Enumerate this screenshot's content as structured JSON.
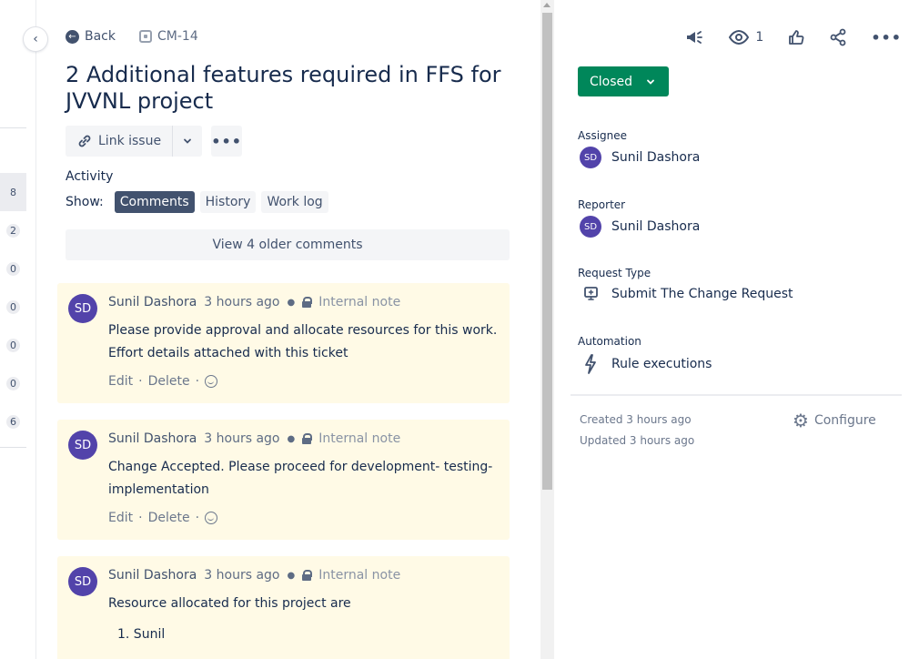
{
  "left_strip": {
    "counts": [
      "8",
      "2",
      "0",
      "0",
      "0",
      "0",
      "6"
    ]
  },
  "nav": {
    "back_label": "Back",
    "issue_key": "CM-14"
  },
  "issue": {
    "title": "2 Additional features required in FFS for JVVNL project"
  },
  "actions": {
    "link_issue": "Link issue",
    "more": "•••"
  },
  "activity": {
    "label": "Activity",
    "show_label": "Show:",
    "filters": [
      "Comments",
      "History",
      "Work log"
    ],
    "active_filter": "Comments",
    "older_comments": "View 4 older comments"
  },
  "comments": [
    {
      "initials": "SD",
      "author": "Sunil Dashora",
      "time": "3 hours ago",
      "visibility": "Internal note",
      "body": "Please provide approval and allocate resources for this work. Effort details attached with this ticket",
      "edit": "Edit",
      "delete": "Delete"
    },
    {
      "initials": "SD",
      "author": "Sunil Dashora",
      "time": "3 hours ago",
      "visibility": "Internal note",
      "body": "Change Accepted. Please proceed for development- testing-implementation",
      "edit": "Edit",
      "delete": "Delete"
    },
    {
      "initials": "SD",
      "author": "Sunil Dashora",
      "time": "3 hours ago",
      "visibility": "Internal note",
      "body": "Resource allocated for this project are",
      "list": [
        "1. Sunil"
      ]
    }
  ],
  "sidebar": {
    "watchers": "1",
    "status": "Closed",
    "status_color": "#00875a",
    "assignee_label": "Assignee",
    "assignee_initials": "SD",
    "assignee": "Sunil Dashora",
    "reporter_label": "Reporter",
    "reporter_initials": "SD",
    "reporter": "Sunil Dashora",
    "request_type_label": "Request Type",
    "request_type": "Submit The Change Request",
    "automation_label": "Automation",
    "automation": "Rule executions",
    "created": "Created 3 hours ago",
    "updated": "Updated 3 hours ago",
    "configure": "Configure"
  }
}
